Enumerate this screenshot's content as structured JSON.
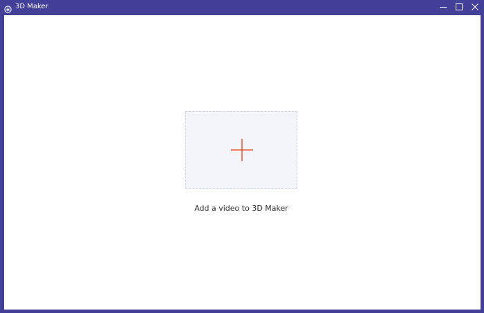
{
  "window": {
    "title": "3D Maker",
    "app_icon": "app-logo-icon",
    "controls": {
      "minimize_icon": "minimize-icon",
      "maximize_icon": "maximize-icon",
      "close_icon": "close-icon"
    },
    "frame_color": "#43409a"
  },
  "main": {
    "dropzone": {
      "icon": "plus-icon",
      "accent_color": "#e8572d",
      "label": "Add a video to 3D Maker"
    }
  }
}
